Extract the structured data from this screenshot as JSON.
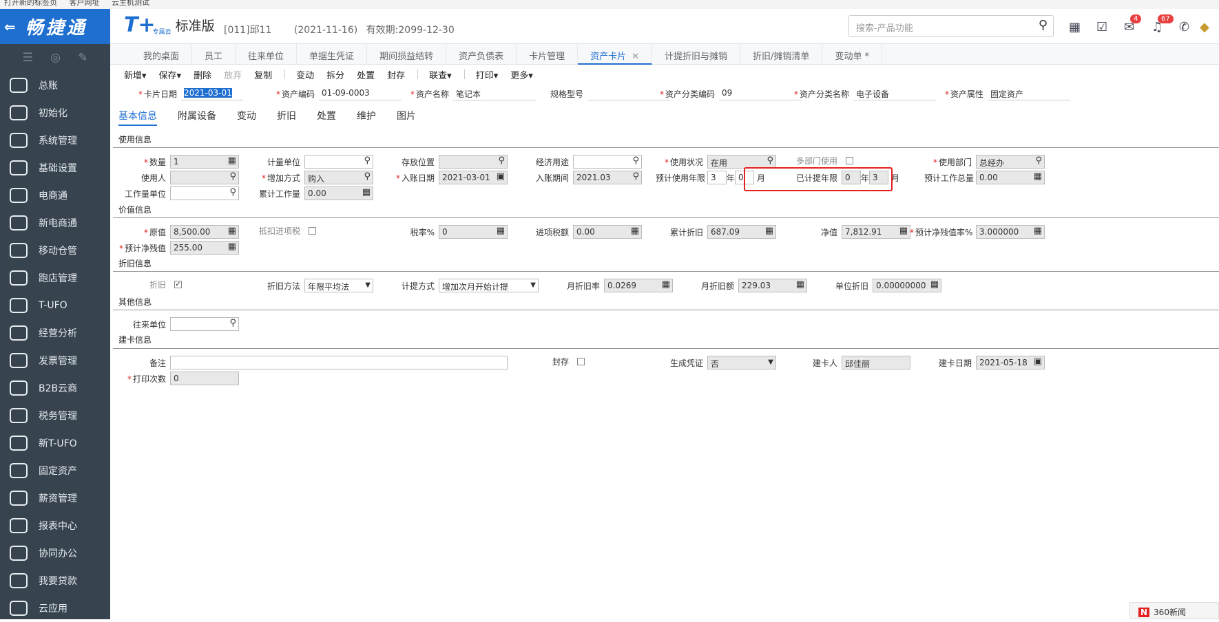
{
  "bookmark": {
    "items": [
      "打开新的标签页",
      "客户网址",
      "云主机测试"
    ]
  },
  "sidebar": {
    "logo": "畅捷通",
    "items": [
      {
        "label": "总账",
        "icon": "ledger-icon"
      },
      {
        "label": "初始化",
        "icon": "refresh-icon"
      },
      {
        "label": "系统管理",
        "icon": "monitor-icon"
      },
      {
        "label": "基础设置",
        "icon": "settings-icon"
      },
      {
        "label": "电商通",
        "icon": "ecommerce-icon"
      },
      {
        "label": "新电商通",
        "icon": "new-ecommerce-icon"
      },
      {
        "label": "移动仓管",
        "icon": "warehouse-icon"
      },
      {
        "label": "跑店管理",
        "icon": "store-icon"
      },
      {
        "label": "T-UFO",
        "icon": "ufo-icon"
      },
      {
        "label": "经营分析",
        "icon": "analysis-icon"
      },
      {
        "label": "发票管理",
        "icon": "invoice-icon"
      },
      {
        "label": "B2B云商",
        "icon": "b2b-icon"
      },
      {
        "label": "税务管理",
        "icon": "tax-icon"
      },
      {
        "label": "新T-UFO",
        "icon": "new-ufo-icon"
      },
      {
        "label": "固定资产",
        "icon": "bank-icon"
      },
      {
        "label": "薪资管理",
        "icon": "salary-icon"
      },
      {
        "label": "报表中心",
        "icon": "report-icon"
      },
      {
        "label": "协同办公",
        "icon": "collab-icon"
      },
      {
        "label": "我要贷款",
        "icon": "loan-icon"
      },
      {
        "label": "云应用",
        "icon": "cloud-icon"
      }
    ]
  },
  "header": {
    "brand": "T+",
    "brand_sub": "专属云",
    "edition": "标准版",
    "account": "[011]邱11",
    "date": "(2021-11-16)",
    "valid": "有效期:2099-12-30",
    "search_placeholder": "搜索-产品功能",
    "badge1": "4",
    "badge2": "67"
  },
  "tabs": [
    "我的桌面",
    "员工",
    "往来单位",
    "单据生凭证",
    "期间损益结转",
    "资产负债表",
    "卡片管理",
    "资产卡片",
    "计提折旧与摊销",
    "折旧/摊销清单",
    "变动单 *"
  ],
  "toolbar": [
    "新增▾",
    "保存▾",
    "删除",
    "放弃",
    "复制",
    "变动",
    "拆分",
    "处置",
    "封存",
    "联查▾",
    "打印▾",
    "更多▾"
  ],
  "top_fields": {
    "card_date": {
      "label": "卡片日期",
      "value": "2021-03-01"
    },
    "asset_code": {
      "label": "资产编码",
      "value": "01-09-0003"
    },
    "asset_name": {
      "label": "资产名称",
      "value": "笔记本"
    },
    "spec": {
      "label": "规格型号",
      "value": ""
    },
    "cat_code": {
      "label": "资产分类编码",
      "value": "09"
    },
    "cat_name": {
      "label": "资产分类名称",
      "value": "电子设备"
    },
    "attr": {
      "label": "资产属性",
      "value": "固定资产"
    }
  },
  "subtabs": [
    "基本信息",
    "附属设备",
    "变动",
    "折旧",
    "处置",
    "维护",
    "图片"
  ],
  "sections": {
    "usage": "使用信息",
    "value": "价值信息",
    "depr": "折旧信息",
    "other": "其他信息",
    "build": "建卡信息"
  },
  "usage": {
    "qty": {
      "label": "数量",
      "value": "1"
    },
    "unit": {
      "label": "计量单位",
      "value": ""
    },
    "location": {
      "label": "存放位置",
      "value": ""
    },
    "purpose": {
      "label": "经济用途",
      "value": ""
    },
    "status": {
      "label": "使用状况",
      "value": "在用"
    },
    "multi_dept": {
      "label": "多部门使用"
    },
    "dept": {
      "label": "使用部门",
      "value": "总经办"
    },
    "user": {
      "label": "使用人",
      "value": ""
    },
    "add_mode": {
      "label": "增加方式",
      "value": "购入"
    },
    "entry_date": {
      "label": "入账日期",
      "value": "2021-03-01"
    },
    "entry_period": {
      "label": "入账期间",
      "value": "2021.03"
    },
    "life": {
      "label": "预计使用年限",
      "years": "3",
      "year_unit": "年",
      "months": "0",
      "month_unit": "月"
    },
    "used": {
      "label": "已计提年限",
      "years": "0",
      "year_unit": "年",
      "months": "3",
      "month_unit": "月"
    },
    "workload_total": {
      "label": "预计工作总量",
      "value": "0.00"
    },
    "workload_unit": {
      "label": "工作量单位",
      "value": ""
    },
    "workload_acc": {
      "label": "累计工作量",
      "value": "0.00"
    }
  },
  "value": {
    "orig": {
      "label": "原值",
      "value": "8,500.00"
    },
    "deduct": {
      "label": "抵扣进项税"
    },
    "tax_rate": {
      "label": "税率%",
      "value": "0"
    },
    "input_tax": {
      "label": "进项税额",
      "value": "0.00"
    },
    "acc_depr": {
      "label": "累计折旧",
      "value": "687.09"
    },
    "net": {
      "label": "净值",
      "value": "7,812.91"
    },
    "resid_rate": {
      "label": "预计净残值率%",
      "value": "3.000000"
    },
    "resid": {
      "label": "预计净残值",
      "value": "255.00"
    }
  },
  "depr": {
    "flag": {
      "label": "折旧"
    },
    "method": {
      "label": "折旧方法",
      "value": "年限平均法"
    },
    "calc": {
      "label": "计提方式",
      "value": "增加次月开始计提"
    },
    "m_rate": {
      "label": "月折旧率",
      "value": "0.0269"
    },
    "m_amt": {
      "label": "月折旧额",
      "value": "229.03"
    },
    "unit_depr": {
      "label": "单位折旧",
      "value": "0.00000000"
    }
  },
  "other": {
    "partner": {
      "label": "往来单位",
      "value": ""
    }
  },
  "build": {
    "note": {
      "label": "备注",
      "value": ""
    },
    "seal": {
      "label": "封存"
    },
    "voucher": {
      "label": "生成凭证",
      "value": "否"
    },
    "creator": {
      "label": "建卡人",
      "value": "邱佳丽"
    },
    "create_date": {
      "label": "建卡日期",
      "value": "2021-05-18"
    },
    "print": {
      "label": "打印次数",
      "value": "0"
    }
  },
  "news": "360新闻"
}
